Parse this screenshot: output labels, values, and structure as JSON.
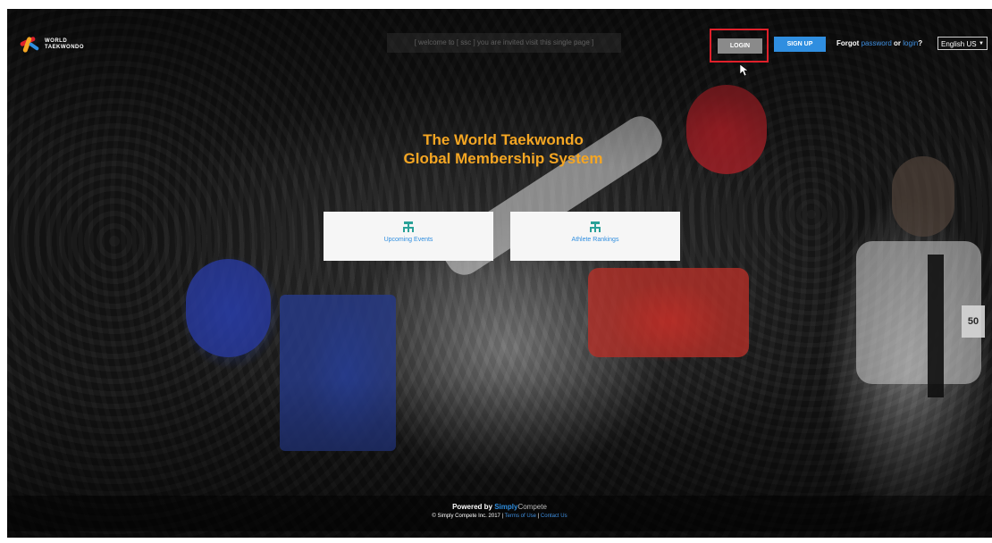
{
  "header": {
    "logo_line1": "WORLD",
    "logo_line2": "TAEKWONDO",
    "search_hint": "[ welcome to [ ssc ] you are invited visit this single page ]",
    "login_label": "LOGIN",
    "signup_label": "SIGN UP",
    "forgot_prefix": "Forgot",
    "forgot_password": "password",
    "forgot_or": "or",
    "forgot_login": "login",
    "forgot_suffix": "?",
    "language": "English US"
  },
  "hero": {
    "title_line1": "The World Taekwondo",
    "title_line2": "Global Membership System",
    "bib_number": "50"
  },
  "cards": [
    {
      "label": "Upcoming Events",
      "icon": "org-chart-icon"
    },
    {
      "label": "Athlete Rankings",
      "icon": "org-chart-icon"
    }
  ],
  "footer": {
    "powered_by": "Powered by",
    "brand_1": "Simply",
    "brand_2": "Compete",
    "copyright": "© Simply Compete Inc. 2017 |",
    "terms": "Terms of Use",
    "separator": "|",
    "contact": "Contact Us"
  },
  "colors": {
    "accent_orange": "#f5a623",
    "link_blue": "#2f8ee0",
    "highlight_red": "#e0202a"
  }
}
